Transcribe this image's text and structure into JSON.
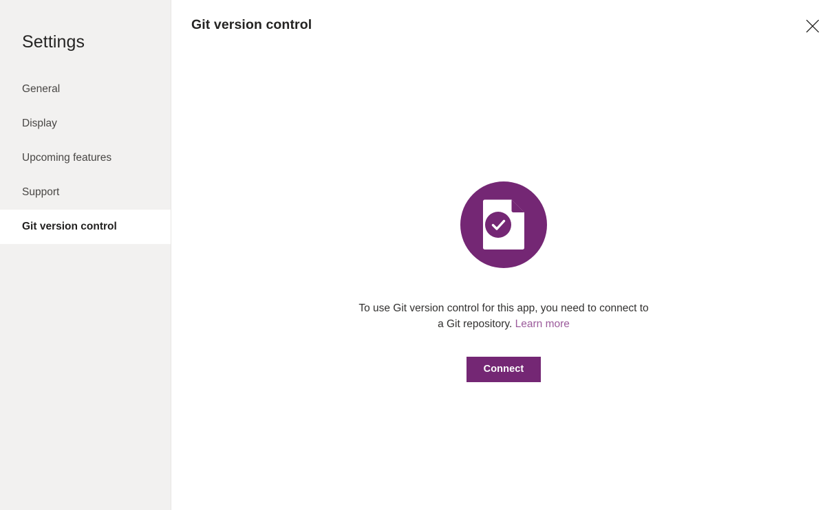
{
  "sidebar": {
    "title": "Settings",
    "items": [
      {
        "label": "General",
        "selected": false
      },
      {
        "label": "Display",
        "selected": false
      },
      {
        "label": "Upcoming features",
        "selected": false
      },
      {
        "label": "Support",
        "selected": false
      },
      {
        "label": "Git version control",
        "selected": true
      }
    ]
  },
  "header": {
    "title": "Git version control",
    "close_icon": "close-icon",
    "close_label": "Close"
  },
  "main": {
    "illustration_icon": "document-check-circle-icon",
    "message_line1": "To use Git version control for this app, you need to",
    "message_line2": "connect to a Git repository.",
    "learn_more_label": "Learn more",
    "connect_label": "Connect"
  },
  "colors": {
    "accent_purple": "#742774",
    "link_purple": "#9b5a9b",
    "sidebar_background": "#f2f1f0",
    "panel_background": "#ffffff",
    "text_primary": "#252423",
    "text_secondary": "#484644"
  }
}
